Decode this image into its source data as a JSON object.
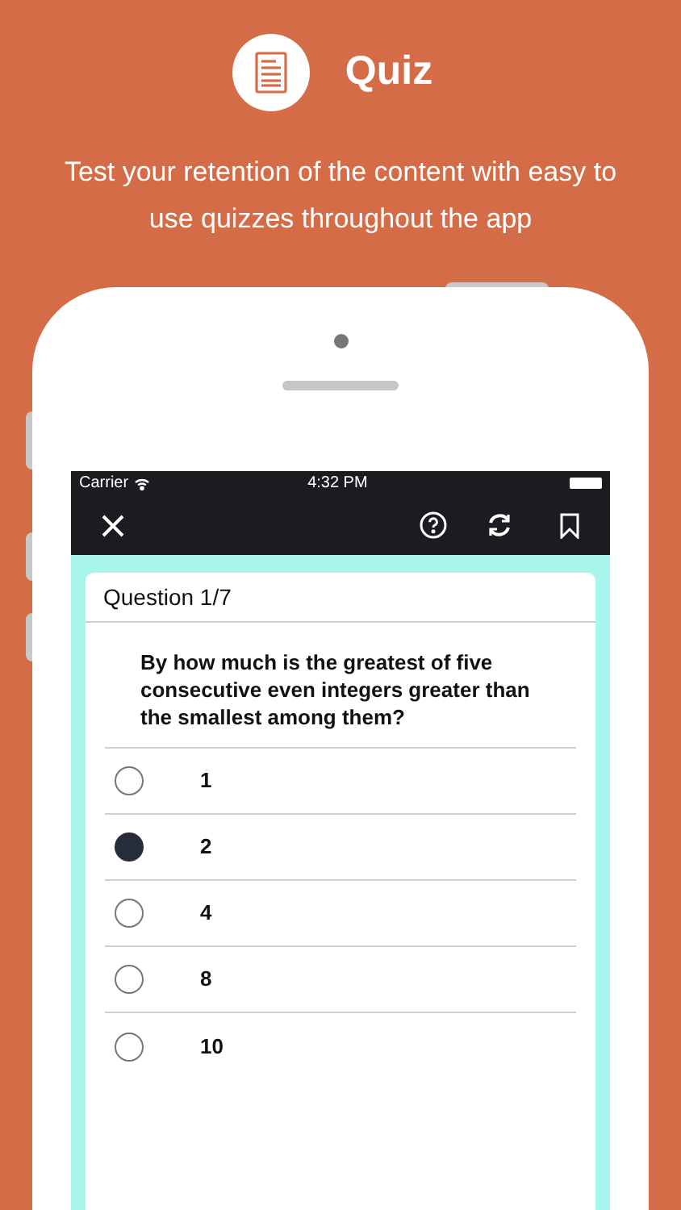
{
  "header": {
    "title": "Quiz",
    "subtitle": "Test your retention of the content with easy to use quizzes throughout the app"
  },
  "status_bar": {
    "carrier": "Carrier",
    "time": "4:32 PM"
  },
  "question": {
    "label": "Question 1/7",
    "text": "By how much is the greatest of five consecutive even integers greater than the smallest among them?",
    "options": [
      {
        "label": "1",
        "selected": false
      },
      {
        "label": "2",
        "selected": true
      },
      {
        "label": "4",
        "selected": false
      },
      {
        "label": "8",
        "selected": false
      },
      {
        "label": "10",
        "selected": false
      }
    ]
  }
}
